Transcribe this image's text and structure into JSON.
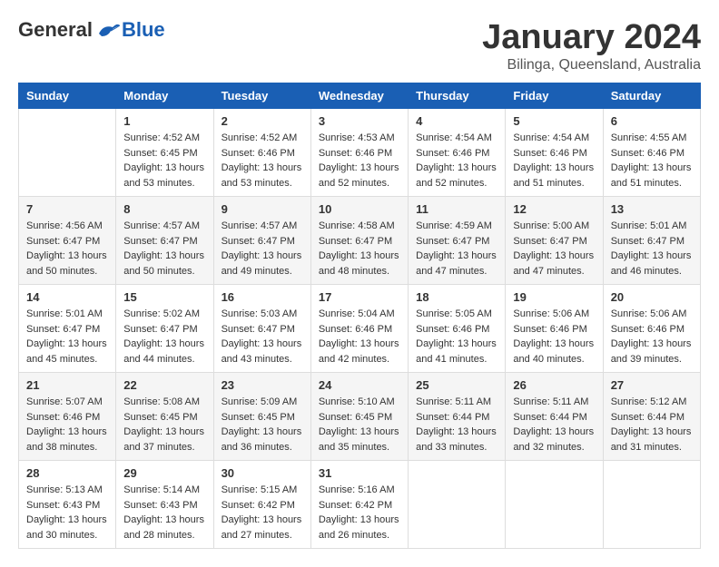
{
  "logo": {
    "general": "General",
    "blue": "Blue"
  },
  "header": {
    "month": "January 2024",
    "location": "Bilinga, Queensland, Australia"
  },
  "days": [
    "Sunday",
    "Monday",
    "Tuesday",
    "Wednesday",
    "Thursday",
    "Friday",
    "Saturday"
  ],
  "weeks": [
    [
      {
        "day": "",
        "info": ""
      },
      {
        "day": "1",
        "info": "Sunrise: 4:52 AM\nSunset: 6:45 PM\nDaylight: 13 hours\nand 53 minutes."
      },
      {
        "day": "2",
        "info": "Sunrise: 4:52 AM\nSunset: 6:46 PM\nDaylight: 13 hours\nand 53 minutes."
      },
      {
        "day": "3",
        "info": "Sunrise: 4:53 AM\nSunset: 6:46 PM\nDaylight: 13 hours\nand 52 minutes."
      },
      {
        "day": "4",
        "info": "Sunrise: 4:54 AM\nSunset: 6:46 PM\nDaylight: 13 hours\nand 52 minutes."
      },
      {
        "day": "5",
        "info": "Sunrise: 4:54 AM\nSunset: 6:46 PM\nDaylight: 13 hours\nand 51 minutes."
      },
      {
        "day": "6",
        "info": "Sunrise: 4:55 AM\nSunset: 6:46 PM\nDaylight: 13 hours\nand 51 minutes."
      }
    ],
    [
      {
        "day": "7",
        "info": "Sunrise: 4:56 AM\nSunset: 6:47 PM\nDaylight: 13 hours\nand 50 minutes."
      },
      {
        "day": "8",
        "info": "Sunrise: 4:57 AM\nSunset: 6:47 PM\nDaylight: 13 hours\nand 50 minutes."
      },
      {
        "day": "9",
        "info": "Sunrise: 4:57 AM\nSunset: 6:47 PM\nDaylight: 13 hours\nand 49 minutes."
      },
      {
        "day": "10",
        "info": "Sunrise: 4:58 AM\nSunset: 6:47 PM\nDaylight: 13 hours\nand 48 minutes."
      },
      {
        "day": "11",
        "info": "Sunrise: 4:59 AM\nSunset: 6:47 PM\nDaylight: 13 hours\nand 47 minutes."
      },
      {
        "day": "12",
        "info": "Sunrise: 5:00 AM\nSunset: 6:47 PM\nDaylight: 13 hours\nand 47 minutes."
      },
      {
        "day": "13",
        "info": "Sunrise: 5:01 AM\nSunset: 6:47 PM\nDaylight: 13 hours\nand 46 minutes."
      }
    ],
    [
      {
        "day": "14",
        "info": "Sunrise: 5:01 AM\nSunset: 6:47 PM\nDaylight: 13 hours\nand 45 minutes."
      },
      {
        "day": "15",
        "info": "Sunrise: 5:02 AM\nSunset: 6:47 PM\nDaylight: 13 hours\nand 44 minutes."
      },
      {
        "day": "16",
        "info": "Sunrise: 5:03 AM\nSunset: 6:47 PM\nDaylight: 13 hours\nand 43 minutes."
      },
      {
        "day": "17",
        "info": "Sunrise: 5:04 AM\nSunset: 6:46 PM\nDaylight: 13 hours\nand 42 minutes."
      },
      {
        "day": "18",
        "info": "Sunrise: 5:05 AM\nSunset: 6:46 PM\nDaylight: 13 hours\nand 41 minutes."
      },
      {
        "day": "19",
        "info": "Sunrise: 5:06 AM\nSunset: 6:46 PM\nDaylight: 13 hours\nand 40 minutes."
      },
      {
        "day": "20",
        "info": "Sunrise: 5:06 AM\nSunset: 6:46 PM\nDaylight: 13 hours\nand 39 minutes."
      }
    ],
    [
      {
        "day": "21",
        "info": "Sunrise: 5:07 AM\nSunset: 6:46 PM\nDaylight: 13 hours\nand 38 minutes."
      },
      {
        "day": "22",
        "info": "Sunrise: 5:08 AM\nSunset: 6:45 PM\nDaylight: 13 hours\nand 37 minutes."
      },
      {
        "day": "23",
        "info": "Sunrise: 5:09 AM\nSunset: 6:45 PM\nDaylight: 13 hours\nand 36 minutes."
      },
      {
        "day": "24",
        "info": "Sunrise: 5:10 AM\nSunset: 6:45 PM\nDaylight: 13 hours\nand 35 minutes."
      },
      {
        "day": "25",
        "info": "Sunrise: 5:11 AM\nSunset: 6:44 PM\nDaylight: 13 hours\nand 33 minutes."
      },
      {
        "day": "26",
        "info": "Sunrise: 5:11 AM\nSunset: 6:44 PM\nDaylight: 13 hours\nand 32 minutes."
      },
      {
        "day": "27",
        "info": "Sunrise: 5:12 AM\nSunset: 6:44 PM\nDaylight: 13 hours\nand 31 minutes."
      }
    ],
    [
      {
        "day": "28",
        "info": "Sunrise: 5:13 AM\nSunset: 6:43 PM\nDaylight: 13 hours\nand 30 minutes."
      },
      {
        "day": "29",
        "info": "Sunrise: 5:14 AM\nSunset: 6:43 PM\nDaylight: 13 hours\nand 28 minutes."
      },
      {
        "day": "30",
        "info": "Sunrise: 5:15 AM\nSunset: 6:42 PM\nDaylight: 13 hours\nand 27 minutes."
      },
      {
        "day": "31",
        "info": "Sunrise: 5:16 AM\nSunset: 6:42 PM\nDaylight: 13 hours\nand 26 minutes."
      },
      {
        "day": "",
        "info": ""
      },
      {
        "day": "",
        "info": ""
      },
      {
        "day": "",
        "info": ""
      }
    ]
  ]
}
